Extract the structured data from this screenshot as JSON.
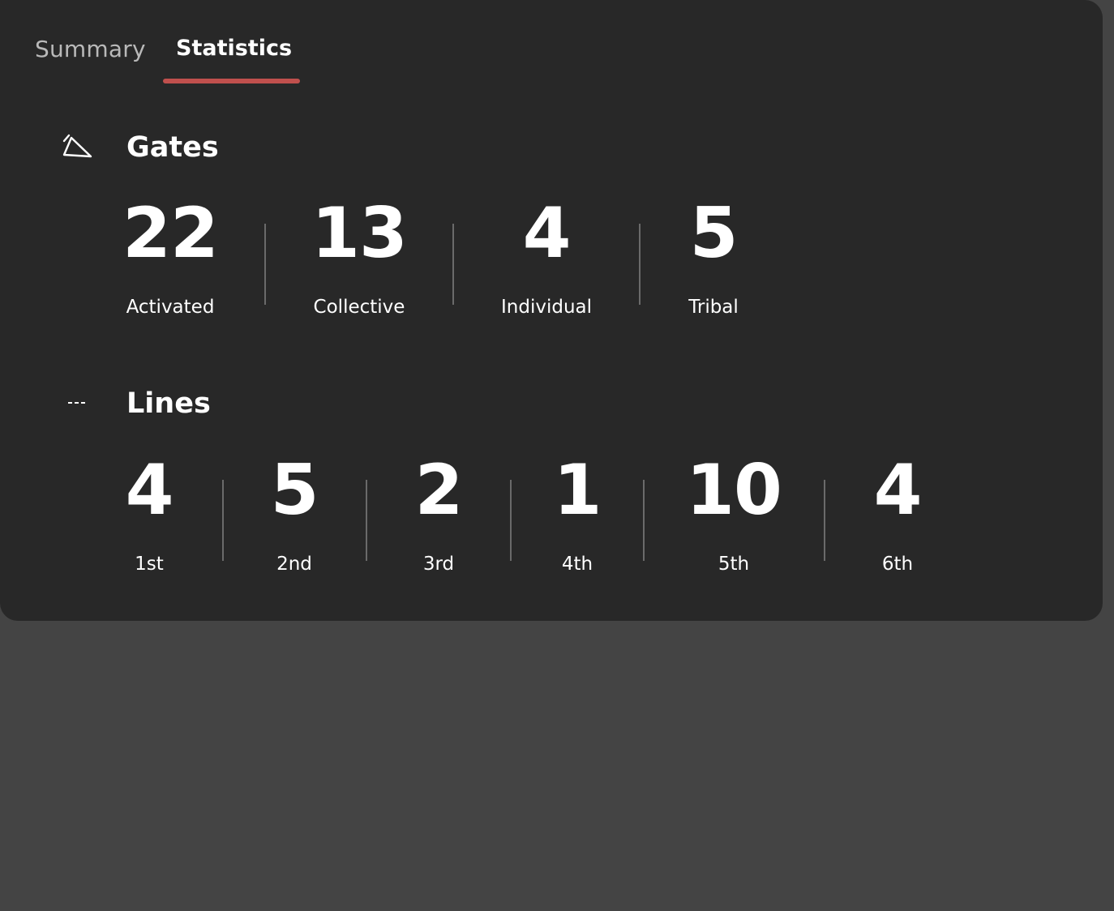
{
  "tabs": [
    {
      "label": "Summary",
      "active": false
    },
    {
      "label": "Statistics",
      "active": true
    }
  ],
  "colors": {
    "page_background": "#444444",
    "card_background": "#282828",
    "accent_underline": "#c0504d",
    "divider": "#6a6a6a",
    "inactive_tab_text": "#b9b9b9"
  },
  "gates": {
    "icon": "triangle-outline-icon",
    "title": "Gates",
    "stats": [
      {
        "value": "22",
        "label": "Activated"
      },
      {
        "value": "13",
        "label": "Collective"
      },
      {
        "value": "4",
        "label": "Individual"
      },
      {
        "value": "5",
        "label": "Tribal"
      }
    ]
  },
  "lines": {
    "icon": "dashed-line-icon",
    "title": "Lines",
    "stats": [
      {
        "value": "4",
        "label": "1st"
      },
      {
        "value": "5",
        "label": "2nd"
      },
      {
        "value": "2",
        "label": "3rd"
      },
      {
        "value": "1",
        "label": "4th"
      },
      {
        "value": "10",
        "label": "5th"
      },
      {
        "value": "4",
        "label": "6th"
      }
    ]
  }
}
